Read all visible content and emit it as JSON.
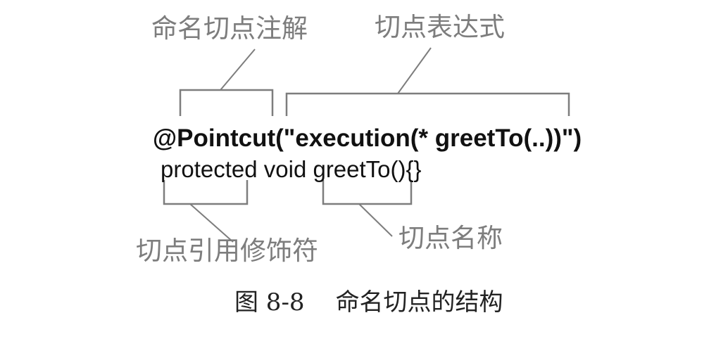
{
  "labels": {
    "named_pointcut_annotation": "命名切点注解",
    "pointcut_expression": "切点表达式",
    "pointcut_reference_modifier": "切点引用修饰符",
    "pointcut_name": "切点名称"
  },
  "code": {
    "line1": "@Pointcut(\"execution(* greetTo(..))\")",
    "line2": "protected void greetTo(){}"
  },
  "caption": {
    "figure_number": "图 8-8",
    "title": "命名切点的结构"
  },
  "colors": {
    "annotation": "#7d7d7d",
    "code": "#111111",
    "background": "#ffffff"
  }
}
